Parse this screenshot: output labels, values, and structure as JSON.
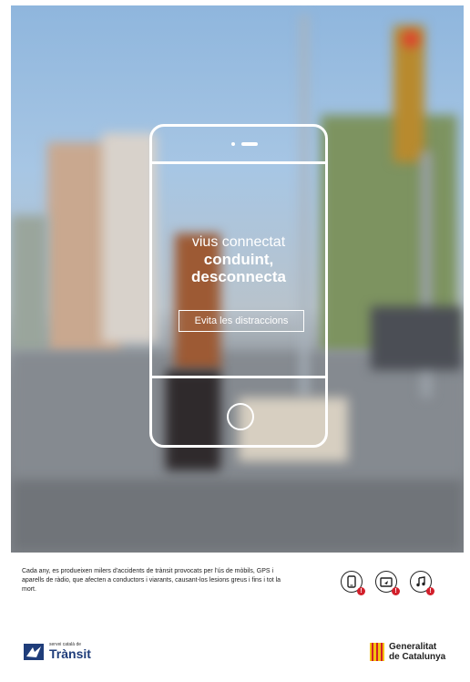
{
  "poster": {
    "tagline_line1": "vius connectat",
    "tagline_line2": "conduint,",
    "tagline_line3": "desconnecta",
    "cta_label": "Evita les distraccions"
  },
  "footer": {
    "info_text": "Cada any, es produeixen milers d'accidents de trànsit provocats per l'ús de mòbils, GPS i aparells de ràdio, que afecten a conductors i viarants, causant-los lesions greus i fins i tot la mort.",
    "icons": [
      "mobile-phone-icon",
      "gps-device-icon",
      "music-note-icon"
    ],
    "alert_mark": "!",
    "accent_color": "#d21f2b"
  },
  "logos": {
    "transit_small": "servei català de",
    "transit_name": "Trànsit",
    "generalitat_line1": "Generalitat",
    "generalitat_line2": "de Catalunya"
  }
}
